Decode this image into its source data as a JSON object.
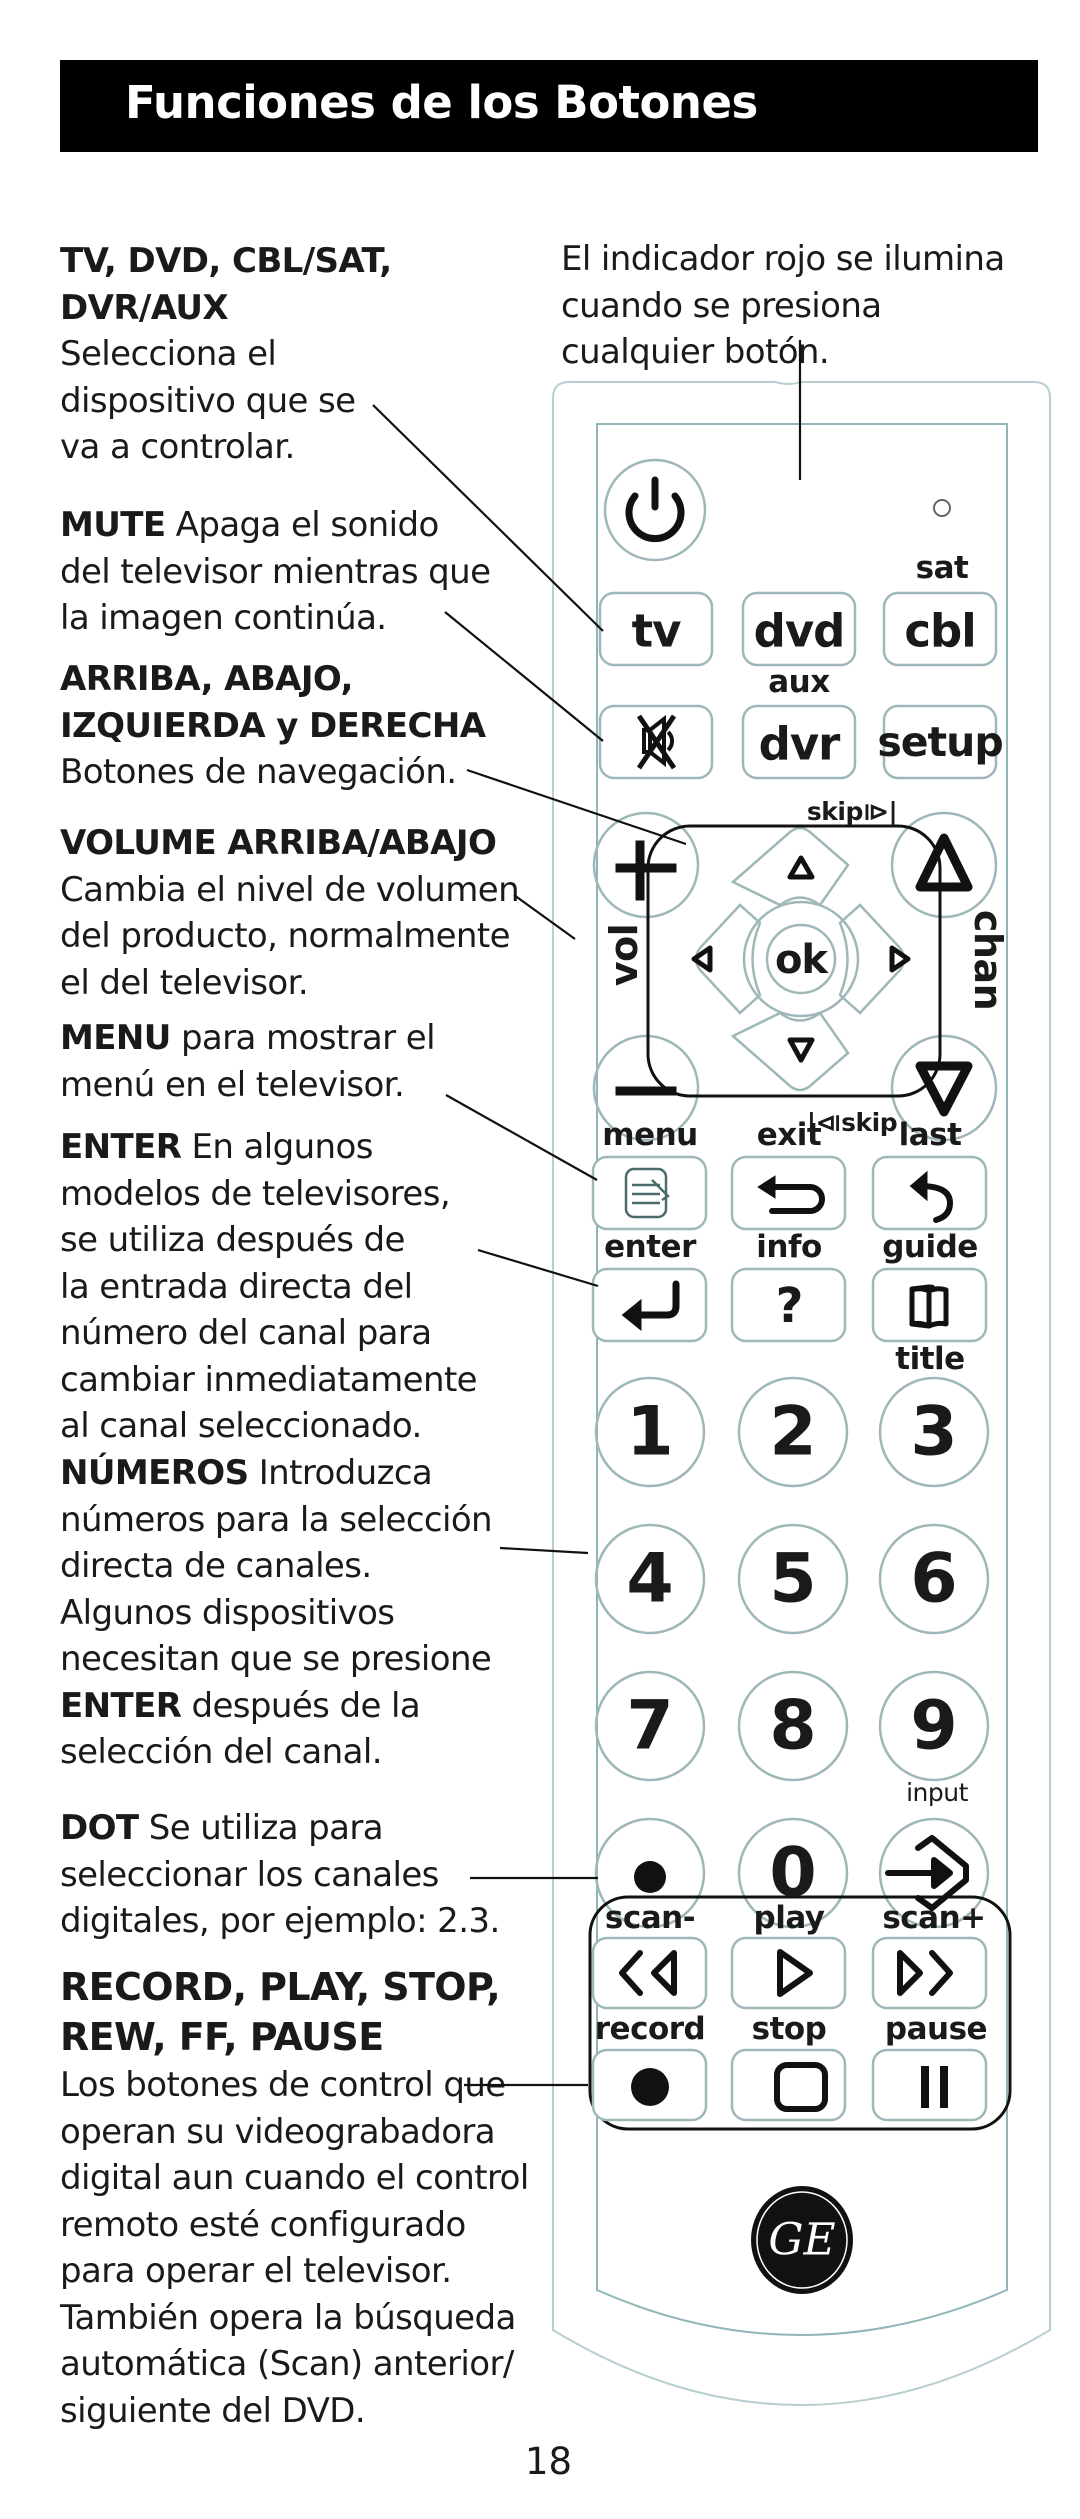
{
  "header": {
    "title": "Funciones de los Botones"
  },
  "caption": {
    "lines": [
      "El indicador rojo se ilumina",
      "cuando se presiona",
      "cualquier botón."
    ]
  },
  "descriptions": [
    {
      "id": "device",
      "heading_lines": [
        "TV, DVD, CBL/SAT,",
        "DVR/AUX"
      ],
      "body_lines": [
        "Selecciona el",
        "dispositivo que se",
        "va a controlar."
      ]
    },
    {
      "id": "mute",
      "lead": "MUTE",
      "lines": [
        " Apaga el sonido",
        "del televisor mientras que",
        "la imagen continúa."
      ]
    },
    {
      "id": "nav",
      "heading_lines": [
        "ARRIBA, ABAJO,",
        "IZQUIERDA y DERECHA"
      ],
      "body_lines": [
        "Botones de navegación."
      ]
    },
    {
      "id": "volume",
      "heading_lines": [
        "VOLUME ARRIBA/ABAJO"
      ],
      "body_lines": [
        "Cambia el nivel de volumen",
        "del producto, normalmente",
        "el del televisor."
      ]
    },
    {
      "id": "menu",
      "lead": "MENU",
      "lines": [
        " para mostrar el",
        "menú en el televisor."
      ]
    },
    {
      "id": "enter",
      "lead": "ENTER",
      "lines": [
        " En algunos",
        "modelos de televisores,",
        "se utiliza después de",
        "la entrada directa del",
        "número del canal para",
        "cambiar inmediatamente",
        "al canal seleccionado."
      ]
    },
    {
      "id": "numbers",
      "lead": "NÚMEROS",
      "lines": [
        " Introduzca",
        "números para la selección",
        "directa de canales.",
        "Algunos dispositivos",
        "necesitan que se presione"
      ],
      "tail_lead": "ENTER",
      "tail_lines": [
        " después de la",
        "selección del canal."
      ]
    },
    {
      "id": "dot",
      "lead": "DOT",
      "lines": [
        " Se utiliza para",
        "seleccionar los canales",
        "digitales, por ejemplo: 2.3."
      ]
    },
    {
      "id": "transport",
      "heading_lines": [
        "RECORD, PLAY, STOP,",
        "REW, FF, PAUSE"
      ],
      "body_lines": [
        "Los botones de control que",
        "operan su videograbadora",
        "digital aun cuando el control",
        "remoto esté configurado",
        "para operar el televisor.",
        "También opera la búsqueda",
        "automática (Scan) anterior/",
        "siguiente del DVD."
      ]
    }
  ],
  "remote": {
    "labels": {
      "sat": "sat",
      "aux": "aux",
      "skip_fwd": "skip⧐|",
      "skip_back": "|⧏skip",
      "vol": "vol",
      "chan": "chan",
      "ok": "ok",
      "menu": "menu",
      "exit": "exit",
      "last": "last",
      "enter": "enter",
      "info": "info",
      "guide": "guide",
      "title": "title",
      "input": "input",
      "scan_minus": "scan-",
      "play": "play",
      "scan_plus": "scan+",
      "record": "record",
      "stop": "stop",
      "pause": "pause"
    },
    "buttons": {
      "tv": "tv",
      "dvd": "dvd",
      "cbl": "cbl",
      "dvr": "dvr",
      "setup": "setup",
      "info_glyph": "?"
    },
    "digits": [
      "1",
      "2",
      "3",
      "4",
      "5",
      "6",
      "7",
      "8",
      "9",
      "0"
    ],
    "brand": "GE",
    "icons": [
      "power-icon",
      "indicator-led-icon",
      "mute-icon",
      "plus-icon",
      "minus-icon",
      "up-arrow-icon",
      "down-arrow-icon",
      "left-arrow-icon",
      "right-arrow-icon",
      "chan-up-icon",
      "chan-down-icon",
      "menu-icon",
      "exit-icon",
      "last-icon",
      "enter-icon",
      "guide-book-icon",
      "dot-icon",
      "input-icon",
      "rewind-icon",
      "play-icon",
      "fast-forward-icon",
      "record-icon",
      "stop-icon",
      "pause-icon"
    ]
  },
  "footer": {
    "page_number": "18"
  }
}
